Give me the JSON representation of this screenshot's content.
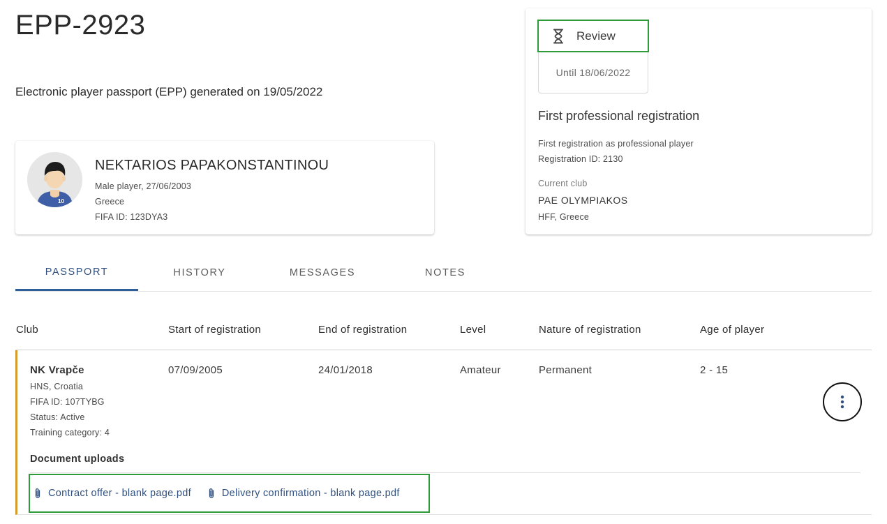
{
  "header": {
    "title": "EPP-2923",
    "subtitle": "Electronic player passport (EPP) generated on 19/05/2022"
  },
  "player": {
    "name": "NEKTARIOS PAPAKONSTANTINOU",
    "details": "Male player, 27/06/2003",
    "country": "Greece",
    "fifa_id": "FIFA ID: 123DYA3",
    "shirt_number": "10"
  },
  "status": {
    "badge_label": "Review",
    "badge_icon": "hourglass-icon",
    "until": "Until 18/06/2022",
    "heading": "First professional registration",
    "description": "First registration as professional player",
    "registration_id": "Registration ID: 2130",
    "current_club_label": "Current club",
    "current_club": "PAE OLYMPIAKOS",
    "current_club_assoc": "HFF, Greece"
  },
  "tabs": [
    {
      "label": "PASSPORT",
      "active": true
    },
    {
      "label": "HISTORY",
      "active": false
    },
    {
      "label": "MESSAGES",
      "active": false
    },
    {
      "label": "NOTES",
      "active": false
    }
  ],
  "table": {
    "columns": [
      "Club",
      "Start of registration",
      "End of registration",
      "Level",
      "Nature of registration",
      "Age of player"
    ],
    "rows": [
      {
        "club": "NK Vrapče",
        "association": "HNS, Croatia",
        "fifa_id": "FIFA ID: 107TYBG",
        "status": "Status: Active",
        "training_category": "Training category: 4",
        "start": "07/09/2005",
        "end": "24/01/2018",
        "level": "Amateur",
        "nature": "Permanent",
        "age": "2 - 15",
        "documents_heading": "Document uploads",
        "documents": [
          {
            "name": "Contract offer - blank page.pdf",
            "icon": "paperclip-icon"
          },
          {
            "name": "Delivery confirmation - blank page.pdf",
            "icon": "paperclip-icon"
          }
        ]
      }
    ]
  },
  "colors": {
    "accent": "#2f5f98",
    "highlight_border": "#2e9a3a",
    "row_marker": "#d49a2a"
  }
}
